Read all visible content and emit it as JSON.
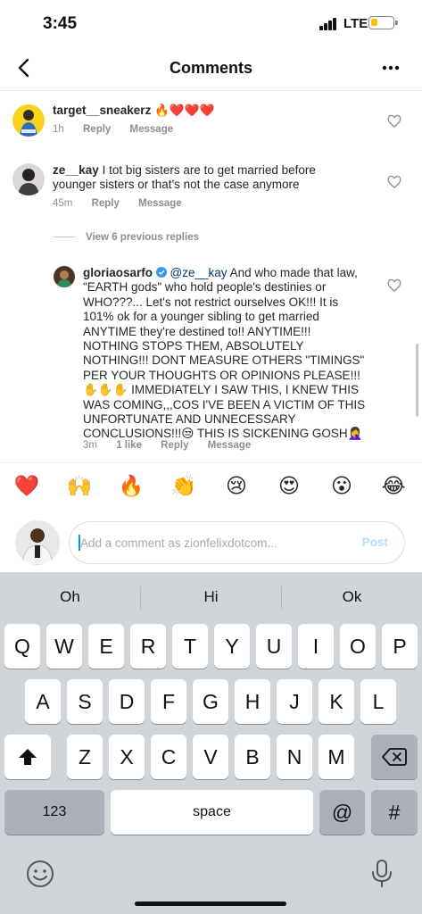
{
  "status_bar": {
    "time": "3:45",
    "network": "LTE",
    "battery_level": 0.3,
    "battery_color": "#f4c20d"
  },
  "header": {
    "title": "Comments"
  },
  "comments": [
    {
      "username": "target__sneakerz",
      "text": "🔥❤️❤️❤️",
      "time": "1h",
      "reply": "Reply",
      "message": "Message"
    },
    {
      "username": "ze__kay",
      "text": "I tot big sisters are to get married before younger sisters or that's not the case anymore",
      "time": "45m",
      "reply": "Reply",
      "message": "Message"
    }
  ],
  "view_replies": "View 6 previous replies",
  "reply": {
    "username": "gloriaosarfo",
    "mention": "@ze__kay",
    "text": "And who made that law, \"EARTH gods\" who hold people's destinies or WHO???... Let's not restrict ourselves OK!!! It is 101% ok for a younger sibling to get married ANYTIME they're destined to!! ANYTIME!!! NOTHING STOPS THEM, ABSOLUTELY NOTHING!!! DONT MEASURE OTHERS \"TIMINGS\" PER YOUR THOUGHTS OR OPINIONS PLEASE!!! ✋✋✋ IMMEDIATELY I SAW THIS, I KNEW THIS WAS COMING,,,COS I'VE BEEN A VICTIM OF THIS UNFORTUNATE AND UNNECESSARY CONCLUSIONS!!!😒 THIS IS SICKENING GOSH🤦‍♀️",
    "time": "3m",
    "likes": "1 like",
    "reply": "Reply",
    "message": "Message"
  },
  "emoji_bar": [
    "❤️",
    "🙌",
    "🔥",
    "👏",
    "😢",
    "😍",
    "😮",
    "😂"
  ],
  "composer": {
    "placeholder": "Add a comment as zionfelixdotcom...",
    "post": "Post"
  },
  "keyboard": {
    "suggestions": [
      "Oh",
      "Hi",
      "Ok"
    ],
    "row1": [
      "Q",
      "W",
      "E",
      "R",
      "T",
      "Y",
      "U",
      "I",
      "O",
      "P"
    ],
    "row2": [
      "A",
      "S",
      "D",
      "F",
      "G",
      "H",
      "J",
      "K",
      "L"
    ],
    "row3": [
      "Z",
      "X",
      "C",
      "V",
      "B",
      "N",
      "M"
    ],
    "numbers": "123",
    "space": "space",
    "at": "@",
    "hash": "#"
  }
}
